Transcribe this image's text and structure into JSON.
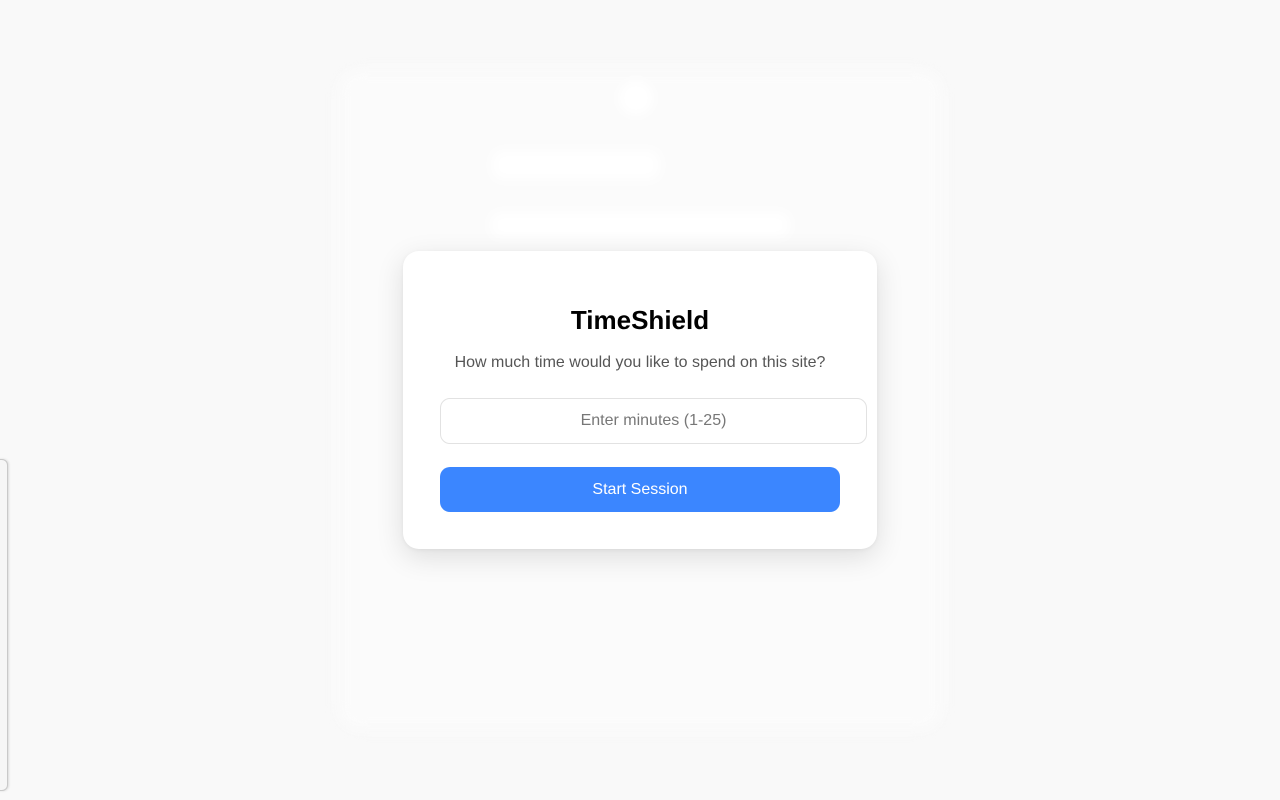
{
  "modal": {
    "title": "TimeShield",
    "question": "How much time would you like to spend on this site?",
    "minutes_input": {
      "value": "",
      "placeholder": "Enter minutes (1-25)"
    },
    "start_button_label": "Start Session"
  },
  "colors": {
    "accent": "#3b86ff",
    "page_background": "#f9f9f9",
    "modal_background": "#ffffff"
  }
}
